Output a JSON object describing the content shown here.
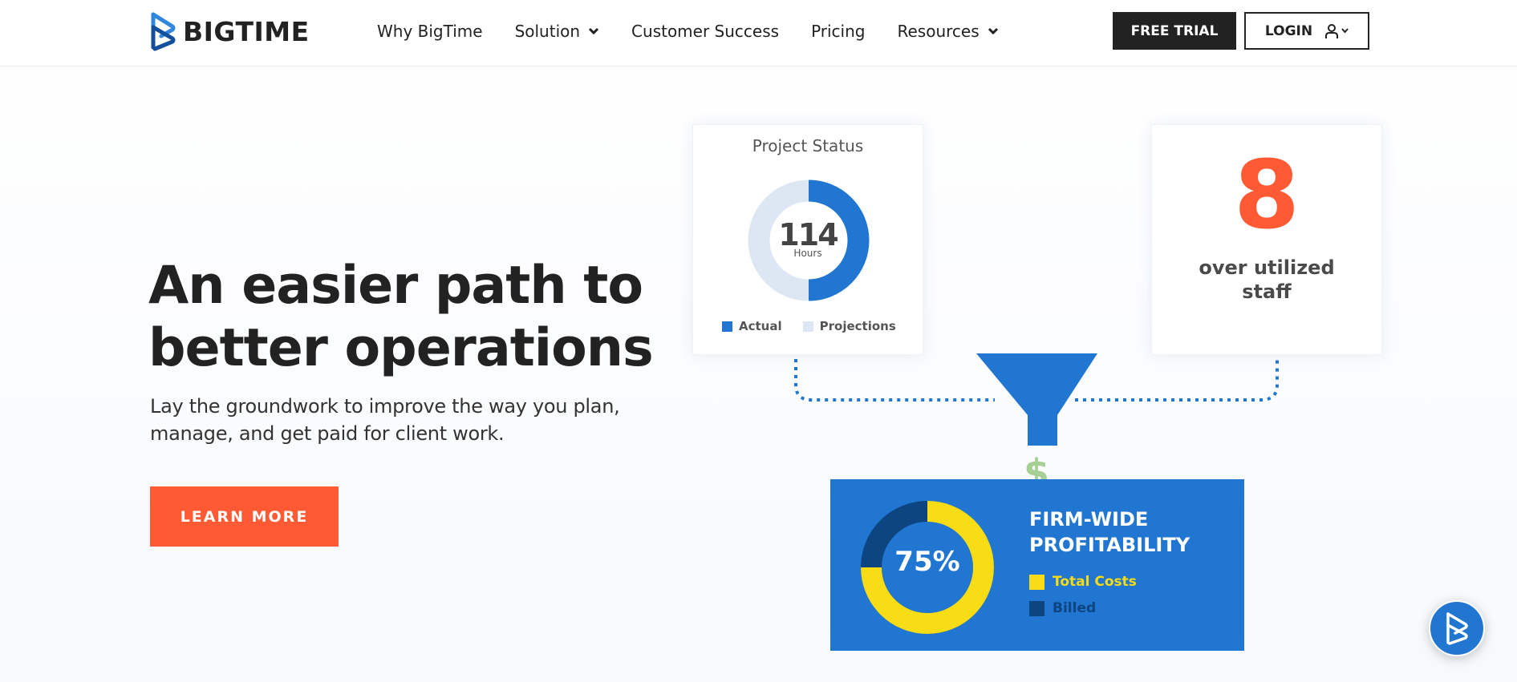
{
  "brand": {
    "name": "BIGTIME",
    "primary_color": "#2176d2",
    "accent_color": "#ff5a33",
    "dark_color": "#222222"
  },
  "header": {
    "nav": [
      {
        "label": "Why BigTime",
        "has_dropdown": false
      },
      {
        "label": "Solution",
        "has_dropdown": true
      },
      {
        "label": "Customer Success",
        "has_dropdown": false
      },
      {
        "label": "Pricing",
        "has_dropdown": false
      },
      {
        "label": "Resources",
        "has_dropdown": true
      }
    ],
    "free_trial_label": "FREE TRIAL",
    "login_label": "LOGIN",
    "login_icon": "user-icon"
  },
  "hero": {
    "title_line1": "An easier path to",
    "title_line2": "better operations",
    "subtitle_line1": "Lay the groundwork to improve the way you plan,",
    "subtitle_line2": "manage, and get paid for client work.",
    "cta_label": "LEARN MORE"
  },
  "project_status_card": {
    "title": "Project Status",
    "value": "114",
    "unit": "Hours",
    "actual_fraction": 0.5,
    "legend": [
      {
        "label": "Actual",
        "color": "#2176d2"
      },
      {
        "label": "Projections",
        "color": "#dde7f4"
      }
    ]
  },
  "staff_card": {
    "value": "8",
    "label_line1": "over utilized",
    "label_line2": "staff"
  },
  "funnel": {
    "color": "#2176d2",
    "dollar_symbol": "$",
    "dollar_color": "#a5cf95"
  },
  "profitability": {
    "value": "75%",
    "title_line1": "FIRM-WIDE",
    "title_line2": "PROFITABILITY",
    "total_costs_fraction": 0.75,
    "legend": [
      {
        "label": "Total Costs",
        "color": "#f7dc16"
      },
      {
        "label": "Billed",
        "color": "#0c4580"
      }
    ]
  },
  "chat_widget": {
    "icon": "bigtime-logo-icon"
  }
}
